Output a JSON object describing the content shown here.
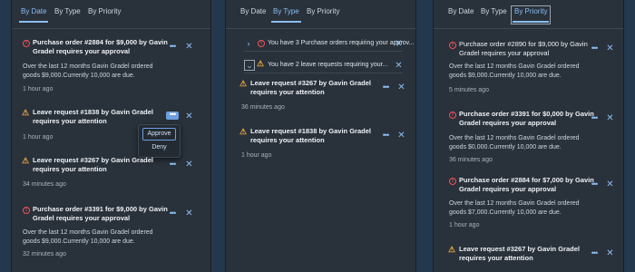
{
  "tabs": {
    "by_date": "By Date",
    "by_type": "By Type",
    "by_priority": "By Priority"
  },
  "icons": {
    "error": "error-circle-icon",
    "warning": "warning-triangle-icon",
    "more": "overflow-menu-icon",
    "close": "close-icon",
    "expand": "chevron-right-icon",
    "collapse": "chevron-down-icon"
  },
  "colors": {
    "accent": "#8bbdf2",
    "error": "#f2545b",
    "warning": "#e9a33d",
    "panel": "#29313a"
  },
  "panel1": {
    "items": [
      {
        "title1": "Purchase order #2884 for $9,000 by Gavin",
        "title2": "Gradel requires your approval",
        "desc1": "Over the last 12 months Gavin Gradel ordered",
        "desc2": "goods $9,000.Currently 10,000 are due.",
        "time": "1 hour ago"
      },
      {
        "title1": "Leave request #1838 by Gavin Gradel",
        "title2": "requires your attention",
        "time": "1 hour ago"
      },
      {
        "title1": "Leave request #3267 by Gavin Gradel",
        "title2": "requires your attention",
        "time": "34 minutes ago"
      },
      {
        "title1": "Purchase order #3391 for $9,000 by Gavin",
        "title2": "Gradel requires your approval",
        "desc1": "Over the last 12 months Gavin Gradel ordered",
        "desc2": "goods $9,000.Currently 10,000 are due.",
        "time": "32 minutes ago"
      }
    ],
    "popover": {
      "approve": "Approve",
      "deny": "Deny"
    }
  },
  "panel2": {
    "groups": [
      {
        "text": "You have 3 Purchase orders requiring your approv..."
      },
      {
        "text": "You have 2 leave requests requiring your..."
      }
    ],
    "items": [
      {
        "title1": "Leave request #3267 by Gavin Gradel",
        "title2": "requires your attention",
        "time": "36 minutes ago"
      },
      {
        "title1": "Leave request #1838 by Gavin Gradel",
        "title2": "requires your attention",
        "time": "1 hour ago"
      }
    ]
  },
  "panel3": {
    "items": [
      {
        "title1": "Purchase order #2890 for $9,000 by Gavin",
        "title2": "Gradel requires your approval",
        "desc1": "Over the last 12 months Gavin Gradel ordered",
        "desc2": "goods $9,000.Currently 10,000 are due.",
        "time": "5 minutes ago"
      },
      {
        "title1": "Purchase order #3391 for $0,000 by Gavin",
        "title2": "Gradel requires your approval",
        "desc1": "Over the last 12 months Gavin Gradel ordered",
        "desc2": "goods $0,000.Currently 10,000 are due.",
        "time": "36 minutes ago"
      },
      {
        "title1": "Purchase order #2884 for $7,000 by Gavin",
        "title2": "Gradel requires your approval",
        "desc1": "Over the last 12 months Gavin Gradel ordered",
        "desc2": "goods $7,000.Currently 10,000 are due.",
        "time": "1 hour ago"
      },
      {
        "title1": "Leave request #3267 by Gavin Gradel",
        "title2": "requires your attention"
      }
    ]
  }
}
